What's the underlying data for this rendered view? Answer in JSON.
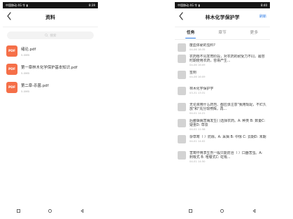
{
  "left": {
    "status_left": "中国移动 4G 令 ▮",
    "status_right": "8:39",
    "title": "资料",
    "search_placeholder": "搜索",
    "files": [
      {
        "icon": "PDF",
        "name": "绪论.pdf",
        "size": "5.0MB"
      },
      {
        "icon": "PDF",
        "name": "第一章林木化学保护基本知识.pdf",
        "size": "5.0MB"
      },
      {
        "icon": "PDF",
        "name": "第二章-杀菌.pdf",
        "size": "5.0MB"
      }
    ]
  },
  "right": {
    "status_left": "中国移动 4G 令 ▮",
    "status_right": "8:40",
    "title": "林木化学保护学",
    "action": "刷新",
    "tabs": [
      {
        "label": "任务",
        "active": true
      },
      {
        "label": "章节",
        "active": false
      },
      {
        "label": "更多",
        "active": false
      }
    ],
    "tasks": [
      {
        "title": "废血体硬的虫料?",
        "time": "04-06 18:35"
      },
      {
        "title": "农药根不同发育阶段，对农药的耐受力不同，最容时期使用农药，容易产生...",
        "time": "04-06 16:09"
      },
      {
        "title": "签到",
        "time": "04-06 16:09"
      },
      {
        "title": "林木化学保护学",
        "time": "03-31 13:31"
      },
      {
        "title": "无论液用什么药剂、都应该注意\"我用现配，不贮久放\"和\"充分现喷辉，再...",
        "time": "04-01 14:21"
      },
      {
        "title": "后腰飘病害病发生(     )选择农药。A: 种类  B: 数量C: 疑重D: 草妆",
        "time": "04-01 11:58"
      },
      {
        "title": "杂草寄（  ）防除。A: 采揖  B: 中惊 C: 云期D: 未期",
        "time": "04-01 14:02"
      },
      {
        "title": "害寄作用表生剂一般只能防治（ ）口器害虫。A: 刺吸式  B: 咀嚼式C: 虹吸...",
        "time": "04-01 14:50"
      }
    ]
  },
  "colors": {
    "accent": "#2d7be5",
    "pdf": "#f56f48",
    "avatar": "#d3d3d3"
  }
}
